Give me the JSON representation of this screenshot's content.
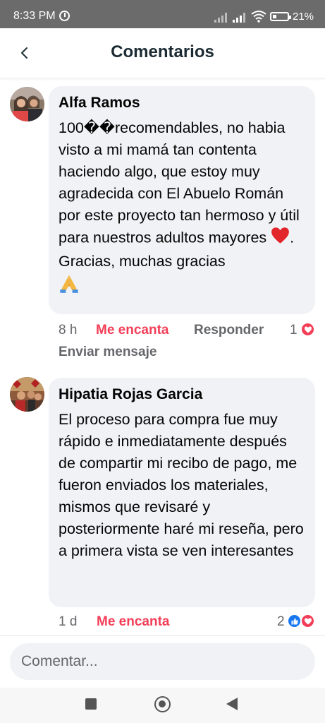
{
  "status_bar": {
    "time": "8:33 PM",
    "battery": "21%"
  },
  "header": {
    "title": "Comentarios"
  },
  "comments": [
    {
      "author": "Alfa Ramos",
      "text_before_emoji": "100��recomendables, no habia visto a mi mamá tan contenta haciendo algo, que estoy muy agradecida con El Abuelo Román por este proyecto tan hermoso y útil para nuestros adultos mayores ",
      "text_after_emoji": ". Gracias, muchas gracias",
      "emojis": [
        "red-heart-icon",
        "folded-hands-icon"
      ],
      "time": "8 h",
      "love_label": "Me encanta",
      "reply_label": "Responder",
      "send_label": "Enviar mensaje",
      "reaction_count": "1",
      "reactions": [
        "love"
      ]
    },
    {
      "author": "Hipatia Rojas Garcia",
      "text": "El proceso para compra fue muy rápido e inmediatamente después de compartir mi recibo de pago, me fueron enviados los materiales, mismos que revisaré y posteriormente haré mi reseña, pero a primera vista se ven interesantes",
      "time": "1 d",
      "love_label": "Me encanta",
      "reaction_count": "2",
      "reactions": [
        "like",
        "love"
      ]
    }
  ],
  "composer": {
    "placeholder": "Comentar..."
  },
  "colors": {
    "love": "#f33e58",
    "like": "#1877f2",
    "bubble": "#f0f2f5",
    "secondary_text": "#65676b"
  }
}
